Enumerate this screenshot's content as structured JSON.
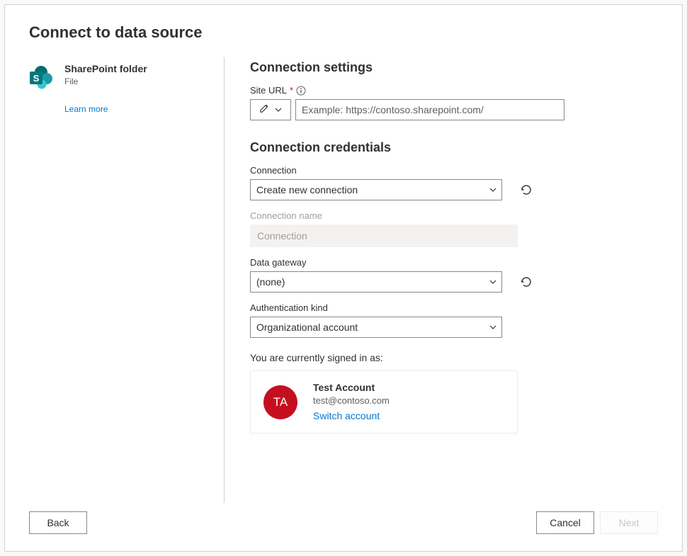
{
  "header": {
    "title": "Connect to data source"
  },
  "source": {
    "title": "SharePoint folder",
    "subtitle": "File",
    "learn_more": "Learn more"
  },
  "settings": {
    "section_title": "Connection settings",
    "site_url_label": "Site URL",
    "site_url_placeholder": "Example: https://contoso.sharepoint.com/"
  },
  "credentials": {
    "section_title": "Connection credentials",
    "connection_label": "Connection",
    "connection_value": "Create new connection",
    "connection_name_label": "Connection name",
    "connection_name_value": "Connection",
    "gateway_label": "Data gateway",
    "gateway_value": "(none)",
    "auth_label": "Authentication kind",
    "auth_value": "Organizational account",
    "signed_in_label": "You are currently signed in as:",
    "account_initials": "TA",
    "account_name": "Test Account",
    "account_email": "test@contoso.com",
    "switch_account": "Switch account"
  },
  "footer": {
    "back": "Back",
    "cancel": "Cancel",
    "next": "Next"
  }
}
